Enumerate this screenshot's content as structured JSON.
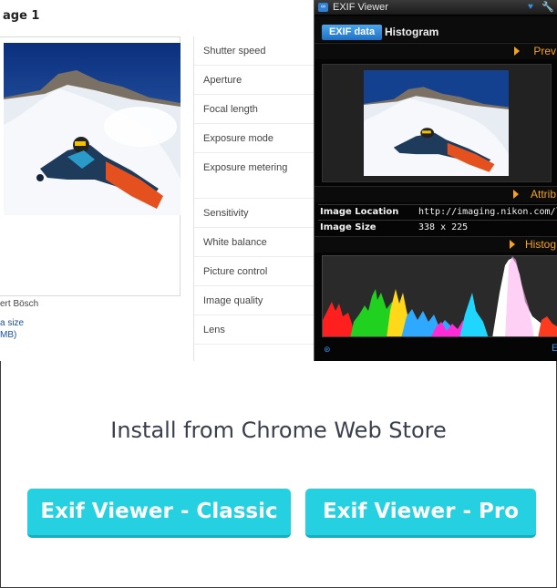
{
  "page": {
    "title_fragment": "age 1",
    "credit_fragment": "ert Bösch",
    "orig_link_line1": "a size",
    "orig_link_line2": "MB)"
  },
  "properties": [
    "Shutter speed",
    "Aperture",
    "Focal length",
    "Exposure mode",
    "Exposure metering",
    "Sensitivity",
    "White balance",
    "Picture control",
    "Image quality",
    "Lens"
  ],
  "viewer": {
    "title": "EXIF Viewer",
    "tabs": [
      "EXIF data",
      "Histogram"
    ],
    "sections": {
      "preview": "Prev",
      "attributes": "Attrib",
      "histogram": "Histog"
    },
    "attributes": [
      {
        "key": "Image Location",
        "value": "http://imaging.nikon.com/line"
      },
      {
        "key": "Image Size",
        "value": "338 x 225"
      }
    ],
    "footer_letter": "E",
    "colors": {
      "accent": "#f4a21b",
      "tab_active": "#2f86d8",
      "panel_bg": "#050505"
    }
  },
  "install": {
    "heading": "Install from Chrome Web Store",
    "buttons": [
      {
        "label": "Exif Viewer - Classic"
      },
      {
        "label": "Exif Viewer - Pro"
      }
    ],
    "button_color": "#25d0e1"
  }
}
